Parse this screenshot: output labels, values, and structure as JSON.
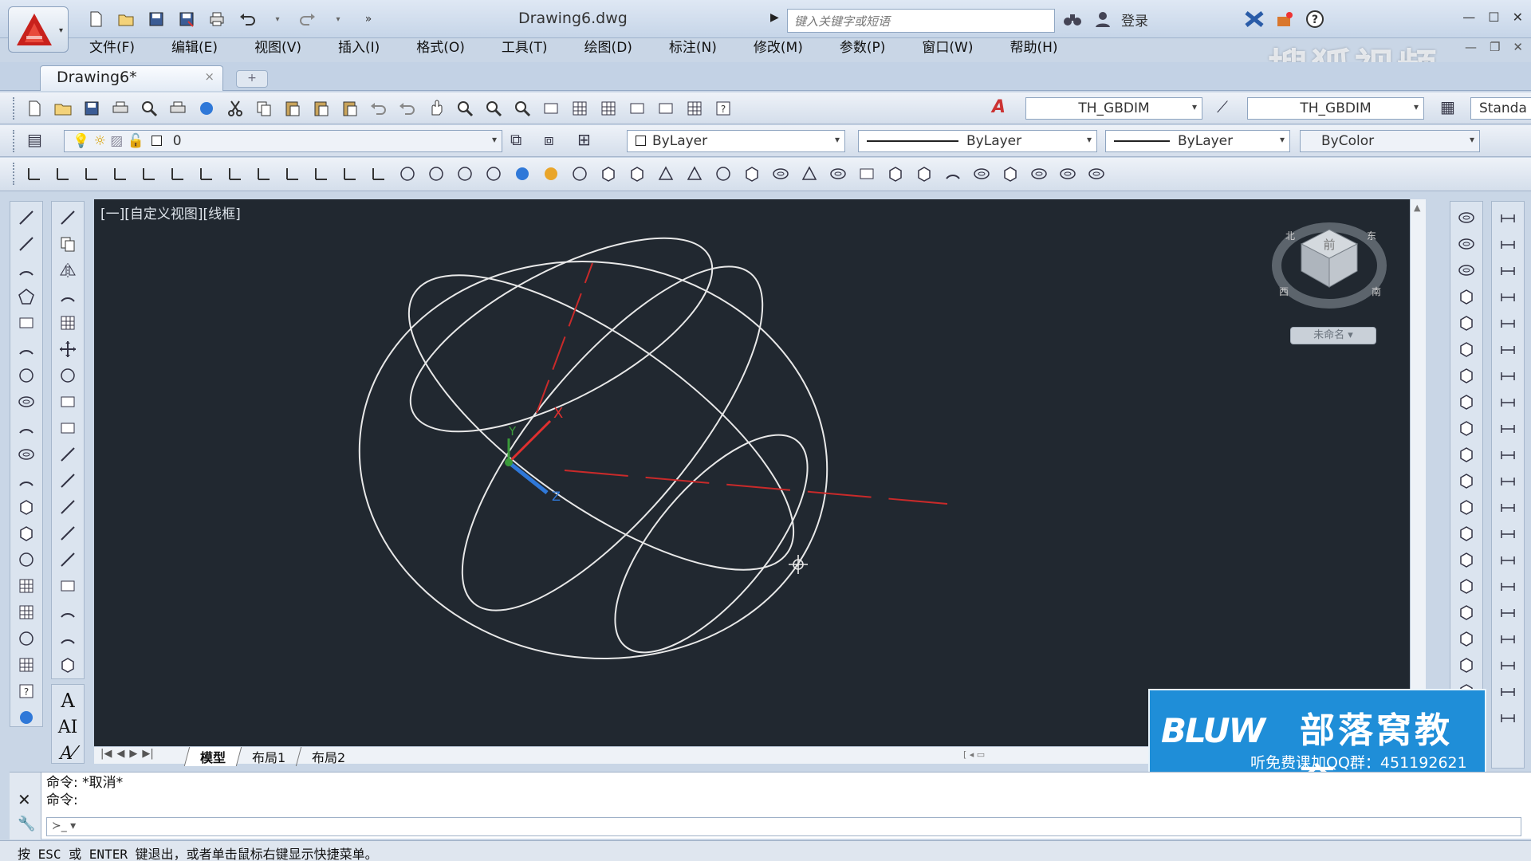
{
  "window": {
    "doc_title": "Drawing6.dwg",
    "search_placeholder": "键入关键字或短语",
    "login": "登录"
  },
  "menu": [
    "文件(F)",
    "编辑(E)",
    "视图(V)",
    "插入(I)",
    "格式(O)",
    "工具(T)",
    "绘图(D)",
    "标注(N)",
    "修改(M)",
    "参数(P)",
    "窗口(W)",
    "帮助(H)"
  ],
  "doc_tab": {
    "label": "Drawing6*",
    "close": "×"
  },
  "styles": {
    "dim_style_1": "TH_GBDIM",
    "dim_style_2": "TH_GBDIM",
    "table_style": "Standa"
  },
  "layer": {
    "current": "0",
    "color": "ByLayer",
    "linetype": "ByLayer",
    "lineweight": "ByLayer",
    "plotstyle": "ByColor"
  },
  "viewport": {
    "label": "[一][自定义视图][线框]",
    "unnamed": "未命名",
    "ucs_axes": {
      "x": "X",
      "y": "Y",
      "z": "Z"
    },
    "viewcube_face": "前",
    "compass": {
      "north": "北",
      "south": "南",
      "west": "西",
      "east": "东"
    },
    "colors": {
      "background": "#212830",
      "wire": "#e8e8e8",
      "x_axis": "#e0302f",
      "y_axis": "#3a9a3a",
      "z_axis": "#2f78d8"
    }
  },
  "layout_tabs": [
    "模型",
    "布局1",
    "布局2"
  ],
  "active_layout": "模型",
  "command": {
    "history": [
      "命令: *取消*",
      "命令:"
    ],
    "input_prompt": "≻_ ▾"
  },
  "status_text": "按 ESC 或 ENTER 键退出，或者单击鼠标右键显示快捷菜单。",
  "watermarks": {
    "sohu": "搜狐视频",
    "bluw_logo": "BLUW",
    "bluw_name": "部落窝教育",
    "bluw_qq": "听免费课加QQ群：451192621"
  }
}
